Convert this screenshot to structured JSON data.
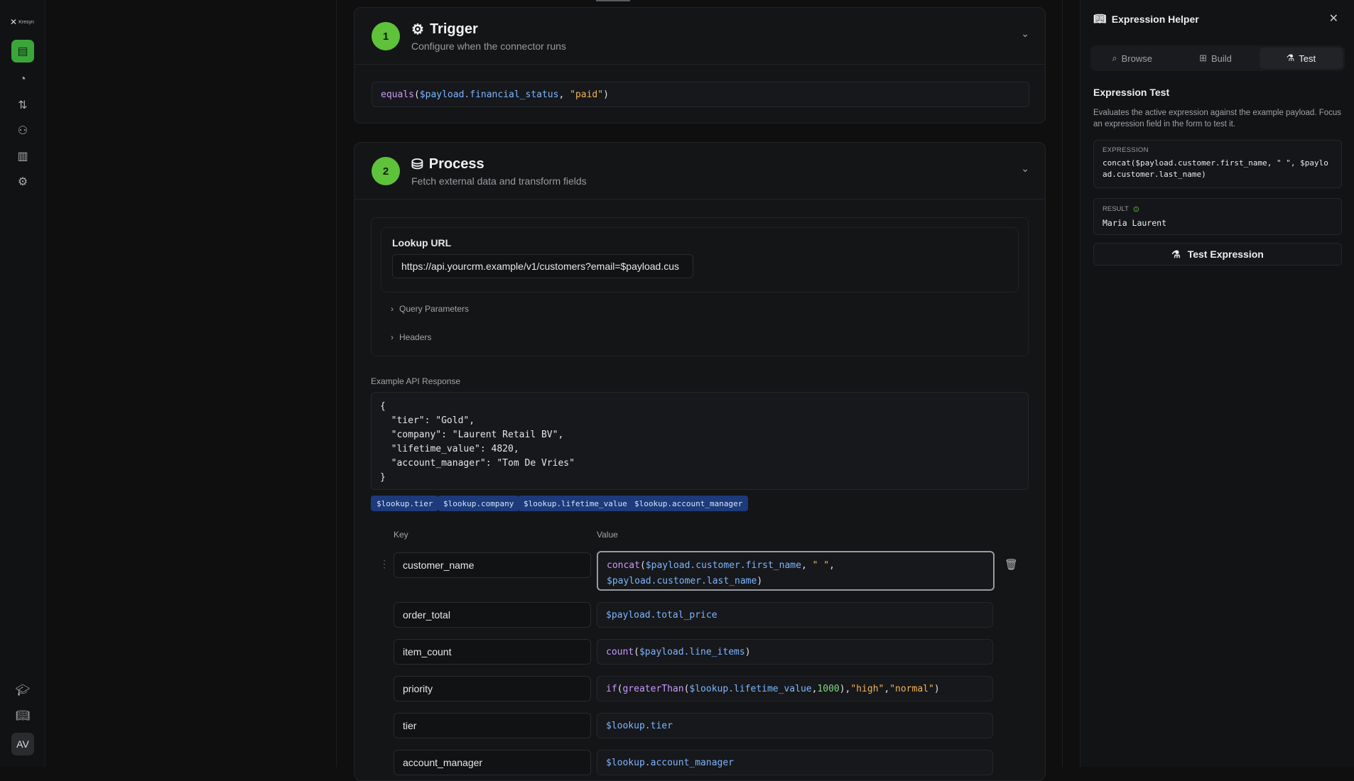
{
  "rail": {
    "logo": "Kresyn",
    "avatar": "AV"
  },
  "trigger": {
    "step": "1",
    "title": "Trigger",
    "subtitle": "Configure when the connector runs",
    "expression": {
      "fn": "equals",
      "var": "$payload.financial_status",
      "str": "\"paid\""
    }
  },
  "process": {
    "step": "2",
    "title": "Process",
    "subtitle": "Fetch external data and transform fields",
    "lookup_label": "Lookup URL",
    "lookup_url": "https://api.yourcrm.example/v1/customers?email=$payload.cus",
    "query_params": "Query Parameters",
    "headers": "Headers",
    "example_label": "Example API Response",
    "example_lines": [
      "{",
      "  \"tier\": \"Gold\",",
      "  \"company\": \"Laurent Retail BV\",",
      "  \"lifetime_value\": 4820,",
      "  \"account_manager\": \"Tom De Vries\"",
      "}"
    ],
    "chips": [
      "$lookup.tier",
      "$lookup.company",
      "$lookup.lifetime_value",
      "$lookup.account_manager"
    ],
    "key_header": "Key",
    "value_header": "Value",
    "rows": [
      {
        "key": "customer_name"
      },
      {
        "key": "order_total"
      },
      {
        "key": "item_count"
      },
      {
        "key": "priority"
      },
      {
        "key": "tier"
      },
      {
        "key": "account_manager"
      }
    ]
  },
  "panel": {
    "title": "Expression Helper",
    "tabs": [
      "Browse",
      "Build",
      "Test"
    ],
    "active_tab": "Test",
    "section_title": "Expression Test",
    "description": "Evaluates the active expression against the example payload. Focus an expression field in the form to test it.",
    "expression_label": "EXPRESSION",
    "expression_value": "concat($payload.customer.first_name, \" \", $payload.customer.last_name)",
    "result_label": "RESULT",
    "result_value": "Maria Laurent",
    "test_button": "Test Expression"
  },
  "colors": {
    "accent": "#5ec23a",
    "chip": "#1d3a7a",
    "fn": "#c79bff",
    "var": "#7cb6ff",
    "str": "#f0b35a",
    "num": "#7ddc7d"
  }
}
